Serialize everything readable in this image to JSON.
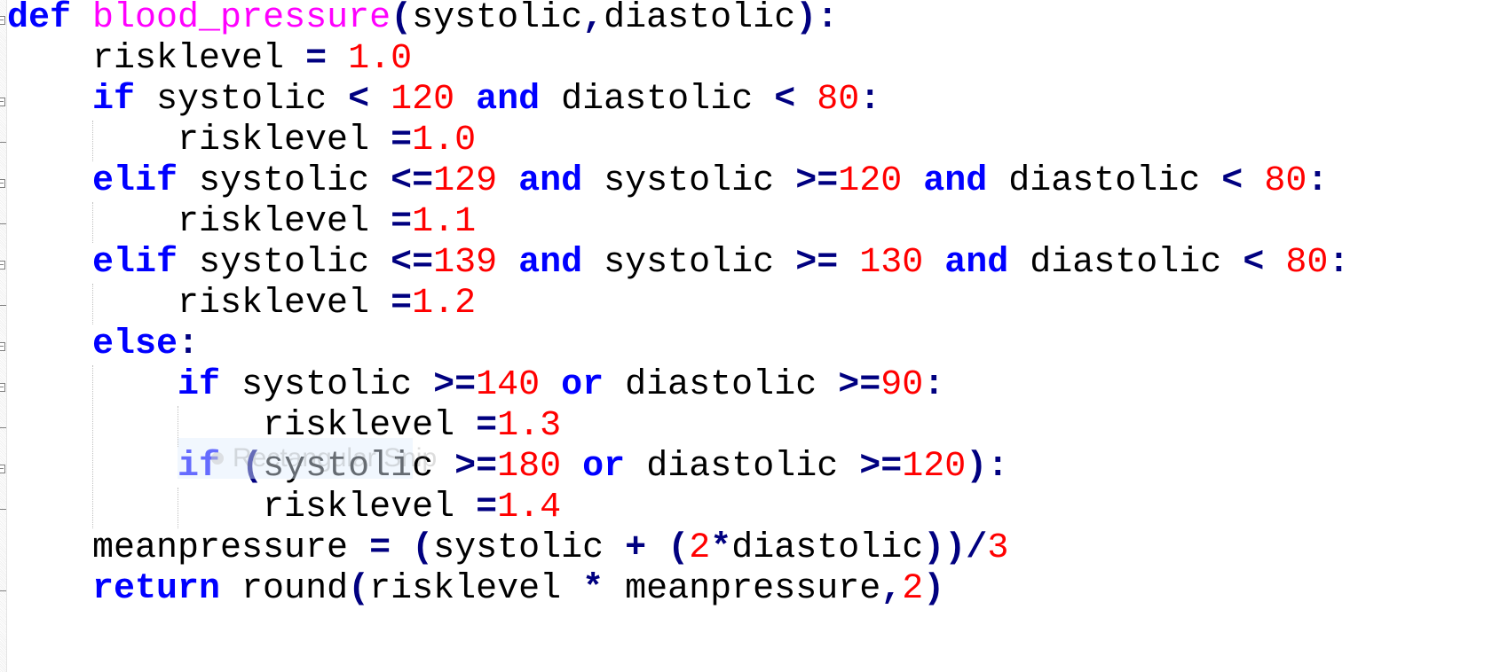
{
  "editor": {
    "language": "python",
    "lines": [
      [
        {
          "t": "kw",
          "v": "def"
        },
        {
          "t": "p",
          "v": " "
        },
        {
          "t": "fn",
          "v": "blood_pressure"
        },
        {
          "t": "op",
          "v": "("
        },
        {
          "t": "p",
          "v": "systolic"
        },
        {
          "t": "op",
          "v": ","
        },
        {
          "t": "p",
          "v": "diastolic"
        },
        {
          "t": "op",
          "v": "):"
        }
      ],
      [
        {
          "t": "p",
          "v": "    risklevel "
        },
        {
          "t": "op",
          "v": "="
        },
        {
          "t": "p",
          "v": " "
        },
        {
          "t": "num",
          "v": "1.0"
        }
      ],
      [
        {
          "t": "p",
          "v": "    "
        },
        {
          "t": "kw",
          "v": "if"
        },
        {
          "t": "p",
          "v": " systolic "
        },
        {
          "t": "op",
          "v": "<"
        },
        {
          "t": "p",
          "v": " "
        },
        {
          "t": "num",
          "v": "120"
        },
        {
          "t": "p",
          "v": " "
        },
        {
          "t": "kw",
          "v": "and"
        },
        {
          "t": "p",
          "v": " diastolic "
        },
        {
          "t": "op",
          "v": "<"
        },
        {
          "t": "p",
          "v": " "
        },
        {
          "t": "num",
          "v": "80"
        },
        {
          "t": "op",
          "v": ":"
        }
      ],
      [
        {
          "t": "p",
          "v": "        risklevel "
        },
        {
          "t": "op",
          "v": "="
        },
        {
          "t": "num",
          "v": "1.0"
        }
      ],
      [
        {
          "t": "p",
          "v": "    "
        },
        {
          "t": "kw",
          "v": "elif"
        },
        {
          "t": "p",
          "v": " systolic "
        },
        {
          "t": "op",
          "v": "<="
        },
        {
          "t": "num",
          "v": "129"
        },
        {
          "t": "p",
          "v": " "
        },
        {
          "t": "kw",
          "v": "and"
        },
        {
          "t": "p",
          "v": " systolic "
        },
        {
          "t": "op",
          "v": ">="
        },
        {
          "t": "num",
          "v": "120"
        },
        {
          "t": "p",
          "v": " "
        },
        {
          "t": "kw",
          "v": "and"
        },
        {
          "t": "p",
          "v": " diastolic "
        },
        {
          "t": "op",
          "v": "<"
        },
        {
          "t": "p",
          "v": " "
        },
        {
          "t": "num",
          "v": "80"
        },
        {
          "t": "op",
          "v": ":"
        }
      ],
      [
        {
          "t": "p",
          "v": "        risklevel "
        },
        {
          "t": "op",
          "v": "="
        },
        {
          "t": "num",
          "v": "1.1"
        }
      ],
      [
        {
          "t": "p",
          "v": "    "
        },
        {
          "t": "kw",
          "v": "elif"
        },
        {
          "t": "p",
          "v": " systolic "
        },
        {
          "t": "op",
          "v": "<="
        },
        {
          "t": "num",
          "v": "139"
        },
        {
          "t": "p",
          "v": " "
        },
        {
          "t": "kw",
          "v": "and"
        },
        {
          "t": "p",
          "v": " systolic "
        },
        {
          "t": "op",
          "v": ">="
        },
        {
          "t": "p",
          "v": " "
        },
        {
          "t": "num",
          "v": "130"
        },
        {
          "t": "p",
          "v": " "
        },
        {
          "t": "kw",
          "v": "and"
        },
        {
          "t": "p",
          "v": " diastolic "
        },
        {
          "t": "op",
          "v": "<"
        },
        {
          "t": "p",
          "v": " "
        },
        {
          "t": "num",
          "v": "80"
        },
        {
          "t": "op",
          "v": ":"
        }
      ],
      [
        {
          "t": "p",
          "v": "        risklevel "
        },
        {
          "t": "op",
          "v": "="
        },
        {
          "t": "num",
          "v": "1.2"
        }
      ],
      [
        {
          "t": "p",
          "v": "    "
        },
        {
          "t": "kw",
          "v": "else"
        },
        {
          "t": "op",
          "v": ":"
        }
      ],
      [
        {
          "t": "p",
          "v": "        "
        },
        {
          "t": "kw",
          "v": "if"
        },
        {
          "t": "p",
          "v": " systolic "
        },
        {
          "t": "op",
          "v": ">="
        },
        {
          "t": "num",
          "v": "140"
        },
        {
          "t": "p",
          "v": " "
        },
        {
          "t": "kw",
          "v": "or"
        },
        {
          "t": "p",
          "v": " diastolic "
        },
        {
          "t": "op",
          "v": ">="
        },
        {
          "t": "num",
          "v": "90"
        },
        {
          "t": "op",
          "v": ":"
        }
      ],
      [
        {
          "t": "p",
          "v": "            risklevel "
        },
        {
          "t": "op",
          "v": "="
        },
        {
          "t": "num",
          "v": "1.3"
        }
      ],
      [
        {
          "t": "p",
          "v": "        "
        },
        {
          "t": "kw",
          "v": "if"
        },
        {
          "t": "p",
          "v": " "
        },
        {
          "t": "op",
          "v": "("
        },
        {
          "t": "p",
          "v": "systolic "
        },
        {
          "t": "op",
          "v": ">="
        },
        {
          "t": "num",
          "v": "180"
        },
        {
          "t": "p",
          "v": " "
        },
        {
          "t": "kw",
          "v": "or"
        },
        {
          "t": "p",
          "v": " diastolic "
        },
        {
          "t": "op",
          "v": ">="
        },
        {
          "t": "num",
          "v": "120"
        },
        {
          "t": "op",
          "v": "):"
        }
      ],
      [
        {
          "t": "p",
          "v": "            risklevel "
        },
        {
          "t": "op",
          "v": "="
        },
        {
          "t": "num",
          "v": "1.4"
        }
      ],
      [
        {
          "t": "p",
          "v": "    meanpressure "
        },
        {
          "t": "op",
          "v": "="
        },
        {
          "t": "p",
          "v": " "
        },
        {
          "t": "op",
          "v": "("
        },
        {
          "t": "p",
          "v": "systolic "
        },
        {
          "t": "op",
          "v": "+"
        },
        {
          "t": "p",
          "v": " "
        },
        {
          "t": "op",
          "v": "("
        },
        {
          "t": "num",
          "v": "2"
        },
        {
          "t": "op",
          "v": "*"
        },
        {
          "t": "p",
          "v": "diastolic"
        },
        {
          "t": "op",
          "v": "))/"
        },
        {
          "t": "num",
          "v": "3"
        }
      ],
      [
        {
          "t": "p",
          "v": "    "
        },
        {
          "t": "kw",
          "v": "return"
        },
        {
          "t": "p",
          "v": " round"
        },
        {
          "t": "op",
          "v": "("
        },
        {
          "t": "p",
          "v": "risklevel "
        },
        {
          "t": "op",
          "v": "*"
        },
        {
          "t": "p",
          "v": " meanpressure"
        },
        {
          "t": "op",
          "v": ","
        },
        {
          "t": "num",
          "v": "2"
        },
        {
          "t": "op",
          "v": ")"
        }
      ]
    ]
  },
  "overlay": {
    "snip_label": "Rectangular Snip"
  },
  "colors": {
    "keyword": "#0000ff",
    "operator": "#000080",
    "number": "#ff0000",
    "function_name": "#ff00ff",
    "default": "#000000"
  }
}
